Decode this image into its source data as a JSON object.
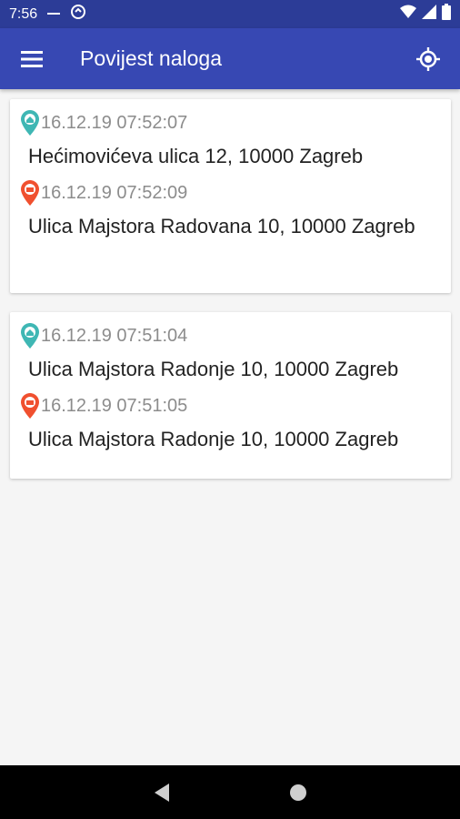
{
  "status_bar": {
    "time": "7:56",
    "icons": [
      "dash-icon",
      "sync-icon",
      "wifi-icon",
      "signal-icon",
      "battery-icon"
    ]
  },
  "app_bar": {
    "title": "Povijest naloga",
    "menu_icon": "menu-icon",
    "location_icon": "my-location-icon",
    "color": "#3748b3"
  },
  "orders": [
    {
      "start_time": "16.12.19 07:52:07",
      "start_address": "Hećimovićeva ulica 12, 10000 Zagreb",
      "end_time": "16.12.19 07:52:09",
      "end_address": "Ulica Majstora Radovana 10, 10000 Zagreb"
    },
    {
      "start_time": "16.12.19 07:51:04",
      "start_address": "Ulica Majstora Radonje 10, 10000 Zagreb",
      "end_time": "16.12.19 07:51:05",
      "end_address": "Ulica Majstora Radonje 10, 10000 Zagreb"
    }
  ],
  "colors": {
    "start_pin": "#3fb7b4",
    "end_pin": "#f0502f"
  },
  "nav_bar": {
    "icons": [
      "back-icon",
      "home-icon"
    ]
  }
}
